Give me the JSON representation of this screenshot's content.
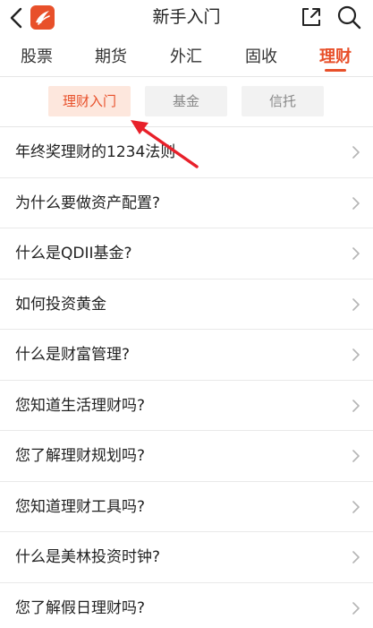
{
  "header": {
    "title": "新手入门"
  },
  "tabs": [
    {
      "label": "股票"
    },
    {
      "label": "期货"
    },
    {
      "label": "外汇"
    },
    {
      "label": "固收"
    },
    {
      "label": "理财"
    }
  ],
  "active_tab": "理财",
  "subtabs": [
    {
      "label": "理财入门"
    },
    {
      "label": "基金"
    },
    {
      "label": "信托"
    }
  ],
  "active_subtab": "理财入门",
  "items": [
    {
      "label": "年终奖理财的1234法则"
    },
    {
      "label": "为什么要做资产配置?"
    },
    {
      "label": "什么是QDII基金?"
    },
    {
      "label": "如何投资黄金"
    },
    {
      "label": "什么是财富管理?"
    },
    {
      "label": "您知道生活理财吗?"
    },
    {
      "label": "您了解理财规划吗?"
    },
    {
      "label": "您知道理财工具吗?"
    },
    {
      "label": "什么是美林投资时钟?"
    },
    {
      "label": "您了解假日理财吗?"
    }
  ],
  "colors": {
    "accent": "#e8502a",
    "subtab_active_bg": "#fde7dd",
    "annotation_arrow": "#e8202a"
  },
  "icons": {
    "back": "chevron-left-icon",
    "logo": "app-logo-icon",
    "share": "share-icon",
    "search": "search-icon",
    "row": "chevron-right-icon"
  }
}
